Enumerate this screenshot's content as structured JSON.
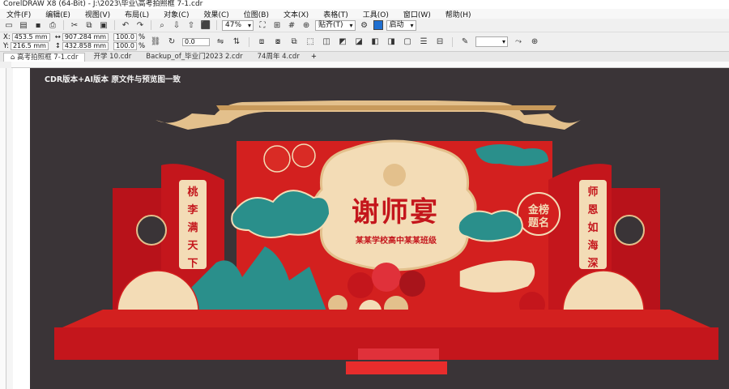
{
  "window": {
    "title": "CorelDRAW X8 (64-Bit) - J:\\2023\\毕业\\高考拍照框 7-1.cdr"
  },
  "menu": [
    "文件(F)",
    "编辑(E)",
    "视图(V)",
    "布局(L)",
    "对象(C)",
    "效果(C)",
    "位图(B)",
    "文本(X)",
    "表格(T)",
    "工具(O)",
    "窗口(W)",
    "帮助(H)"
  ],
  "toolbar": {
    "zoom": "47%",
    "snap": "贴齐(T)",
    "launch": "启动"
  },
  "propbar": {
    "x_label": "X:",
    "x_value": "453.5 mm",
    "y_label": "Y:",
    "y_value": "216.5 mm",
    "w_value": "907.284 mm",
    "h_value": "432.858 mm",
    "scale_w": "100.0",
    "scale_h": "100.0",
    "percent": "%",
    "angle": "0.0"
  },
  "tabs": [
    {
      "label": "高考拍照框 7-1.cdr",
      "active": true
    },
    {
      "label": "开学 10.cdr",
      "active": false
    },
    {
      "label": "Backup_of_毕业门2023 2.cdr",
      "active": false
    },
    {
      "label": "74周年 4.cdr",
      "active": false
    }
  ],
  "canvas": {
    "caption": "CDR版本+AI版本   原文件与预览图一致",
    "art": {
      "main_title": "谢师宴",
      "subtitle": "某某学校高中某某班级",
      "badge_top": "金榜",
      "badge_bottom": "题名",
      "left_banner": [
        "桃",
        "李",
        "满",
        "天",
        "下"
      ],
      "right_banner": [
        "师",
        "恩",
        "如",
        "海",
        "深"
      ]
    }
  },
  "colors": {
    "stage_bg": "#3a3437",
    "red": "#d3201f",
    "deep_red": "#a8141b",
    "gold": "#e6c58f",
    "cream": "#f3dcb6",
    "teal": "#2a8f8b"
  }
}
